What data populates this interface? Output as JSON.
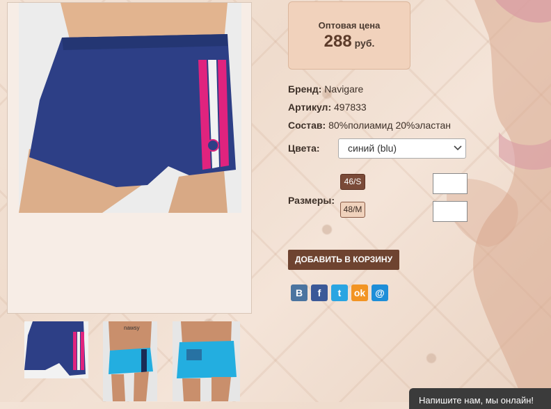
{
  "price": {
    "label": "Оптовая цена",
    "value": "288",
    "unit": "руб."
  },
  "attributes": {
    "brand_label": "Бренд:",
    "brand_value": "Navigare",
    "article_label": "Артикул:",
    "article_value": "497833",
    "composition_label": "Состав:",
    "composition_value": "80%полиамид 20%эластан"
  },
  "colors": {
    "label": "Цвета:",
    "selected": "синий (blu)"
  },
  "sizes": {
    "label": "Размеры:",
    "options": [
      "46/S",
      "48/M"
    ],
    "quantities": [
      "",
      ""
    ]
  },
  "cart": {
    "add_label": "ДОБАВИТЬ В КОРЗИНУ"
  },
  "share": {
    "vk": "В",
    "fb": "f",
    "tw": "t",
    "ok": "ok",
    "mail": "@"
  },
  "thumbnails": {
    "print_text": "nawsy"
  },
  "chat": {
    "label": "Напишите нам, мы онлайн!"
  },
  "colors_palette": {
    "accent": "#6e4330",
    "price_bg": "#f1d2bc",
    "swim_blue": "#2d3f86",
    "swim_pink": "#e0237e"
  }
}
